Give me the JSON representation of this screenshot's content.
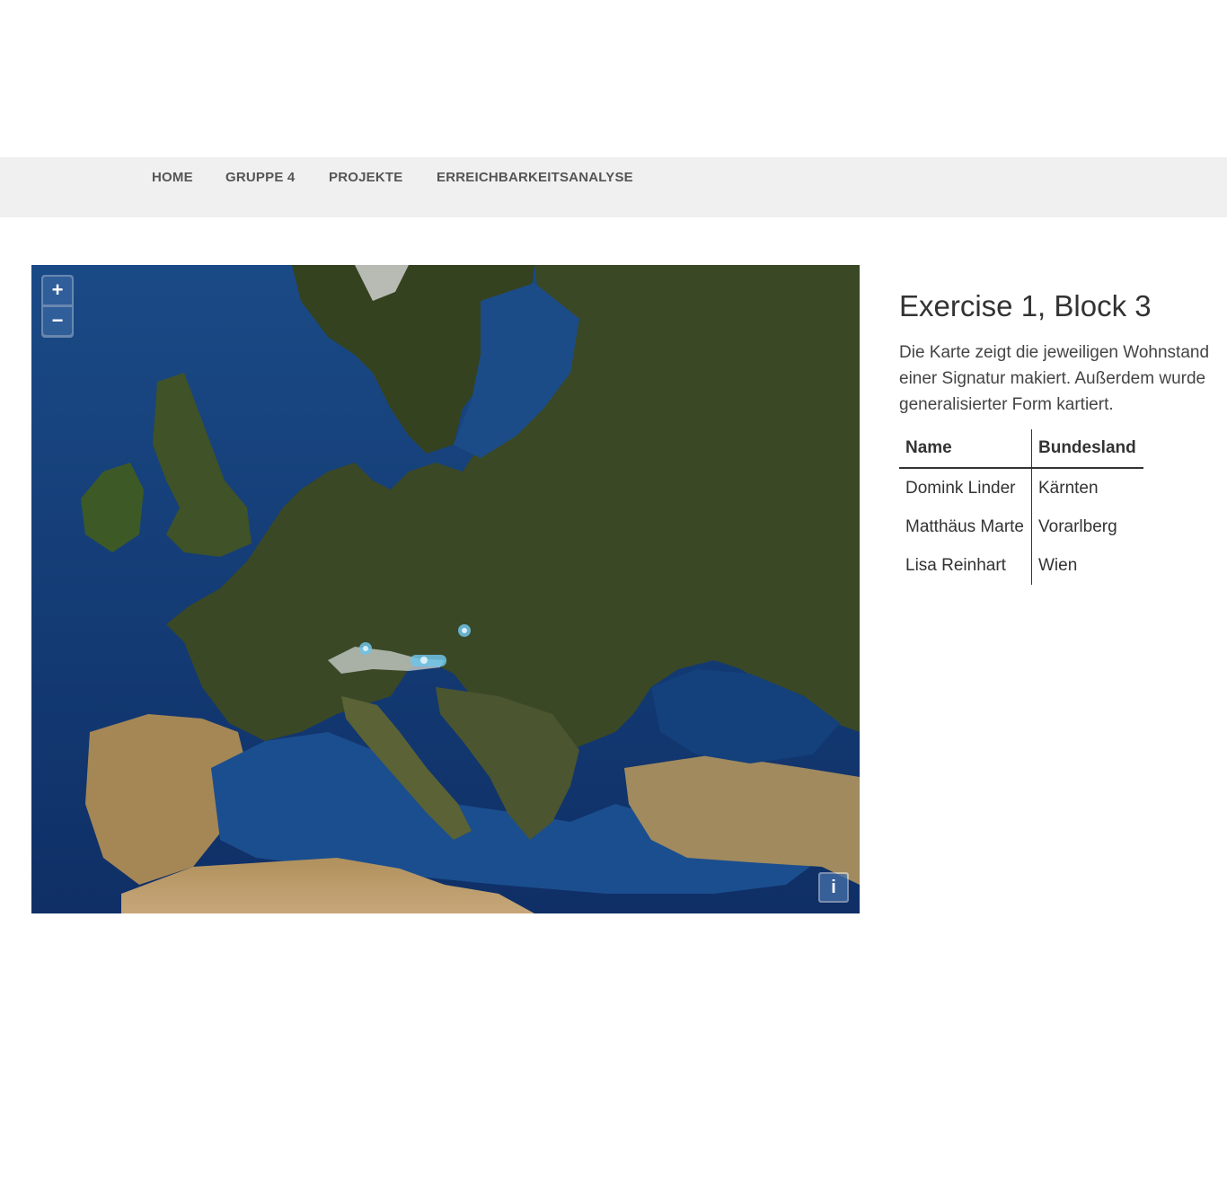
{
  "nav": {
    "items": [
      {
        "label": "HOME"
      },
      {
        "label": "GRUPPE 4"
      },
      {
        "label": "PROJEKTE"
      },
      {
        "label": "ERREICHBARKEITSANALYSE"
      }
    ]
  },
  "map": {
    "zoom_in_label": "+",
    "zoom_out_label": "−",
    "info_label": "i",
    "colors": {
      "sea": "#1d4f8a",
      "land": "#3b4a26",
      "dry": "#a4885a",
      "marker": "#6ec3e8"
    }
  },
  "content": {
    "title": "Exercise 1, Block 3",
    "description_lines": [
      "Die Karte zeigt die jeweiligen Wohnstand",
      "einer Signatur makiert. Außerdem wurde",
      "generalisierter Form kartiert."
    ],
    "table": {
      "headers": [
        "Name",
        "Bundesland"
      ],
      "rows": [
        [
          "Domink Linder",
          "Kärnten"
        ],
        [
          "Matthäus Marte",
          "Vorarlberg"
        ],
        [
          "Lisa Reinhart",
          "Wien"
        ]
      ]
    }
  }
}
